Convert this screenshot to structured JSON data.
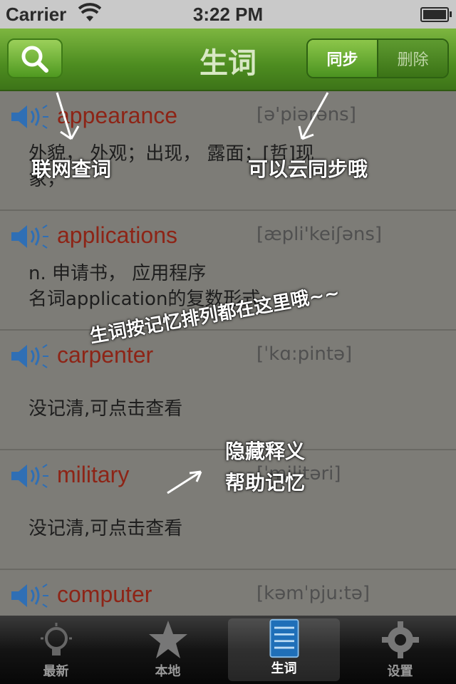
{
  "status_bar": {
    "carrier": "Carrier",
    "time": "3:22 PM"
  },
  "nav": {
    "title": "生词",
    "sync_label": "同步",
    "delete_label": "删除",
    "search_icon": "search-icon"
  },
  "words": [
    {
      "word": "appearance",
      "phonetic": "[ə'piərəns]",
      "definition_1": "外貌， 外观；出现， 露面；[哲]现",
      "definition_2": "象，",
      "speaker_icon": "speaker-icon"
    },
    {
      "word": "applications",
      "phonetic": "[æpli'keiʃəns]",
      "definition_1": "n. 申请书， 应用程序",
      "definition_2": "名词application的复数形式",
      "speaker_icon": "speaker-icon"
    },
    {
      "word": "carpenter",
      "phonetic": "[ˈkɑ:pintə]",
      "definition_1": "没记清,可点击查看",
      "speaker_icon": "speaker-icon"
    },
    {
      "word": "military",
      "phonetic": "[ˈmilitəri]",
      "definition_1": "没记清,可点击查看",
      "speaker_icon": "speaker-icon"
    },
    {
      "word": "computer",
      "phonetic": "[kəmˈpju:tə]",
      "speaker_icon": "speaker-icon"
    }
  ],
  "annotations": {
    "search_hint": "联网查词",
    "sync_hint": "可以云同步哦",
    "sort_hint": "生词按记忆排列都在这里哦~~",
    "hide_hint_1": "隐藏释义",
    "hide_hint_2": "帮助记忆"
  },
  "tabs": [
    {
      "label": "最新",
      "icon": "lightbulb-icon"
    },
    {
      "label": "本地",
      "icon": "star-icon"
    },
    {
      "label": "生词",
      "icon": "notebook-icon",
      "active": true
    },
    {
      "label": "设置",
      "icon": "gear-icon"
    }
  ]
}
